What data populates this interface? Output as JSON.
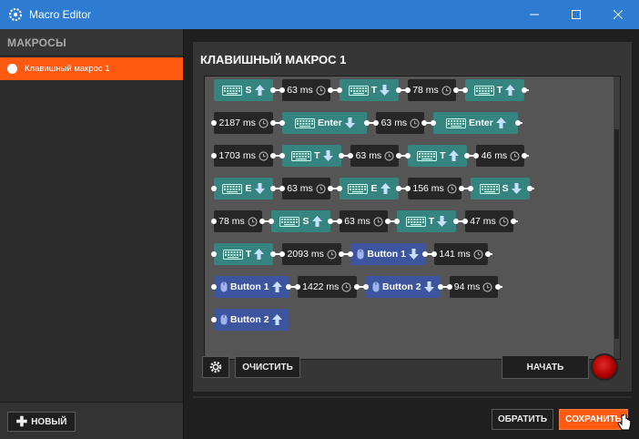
{
  "window": {
    "title": "Macro Editor",
    "icons": {
      "app": "steelseries-gear-icon",
      "minimize": "minimize-icon",
      "maximize": "maximize-icon",
      "close": "close-icon"
    }
  },
  "sidebar": {
    "header": "МАКРОСЫ",
    "items": [
      {
        "label": "Клавишный макрос 1",
        "selected": true
      }
    ],
    "new_button": "НОВЫЙ"
  },
  "main": {
    "title": "КЛАВИШНЫЙ МАКРОС 1",
    "sequence": [
      [
        {
          "type": "key",
          "label": "S",
          "dir": "up"
        },
        {
          "type": "delay",
          "label": "63 ms"
        },
        {
          "type": "key",
          "label": "T",
          "dir": "down"
        },
        {
          "type": "delay",
          "label": "78 ms"
        },
        {
          "type": "key",
          "label": "T",
          "dir": "up"
        }
      ],
      [
        {
          "type": "delay",
          "label": "2187 ms"
        },
        {
          "type": "key",
          "label": "Enter",
          "dir": "down"
        },
        {
          "type": "delay",
          "label": "63 ms"
        },
        {
          "type": "key",
          "label": "Enter",
          "dir": "up"
        }
      ],
      [
        {
          "type": "delay",
          "label": "1703 ms"
        },
        {
          "type": "key",
          "label": "T",
          "dir": "down"
        },
        {
          "type": "delay",
          "label": "63 ms"
        },
        {
          "type": "key",
          "label": "T",
          "dir": "up"
        },
        {
          "type": "delay",
          "label": "46 ms"
        }
      ],
      [
        {
          "type": "key",
          "label": "E",
          "dir": "down"
        },
        {
          "type": "delay",
          "label": "63 ms"
        },
        {
          "type": "key",
          "label": "E",
          "dir": "up"
        },
        {
          "type": "delay",
          "label": "156 ms"
        },
        {
          "type": "key",
          "label": "S",
          "dir": "down"
        }
      ],
      [
        {
          "type": "delay",
          "label": "78 ms"
        },
        {
          "type": "key",
          "label": "S",
          "dir": "up"
        },
        {
          "type": "delay",
          "label": "63 ms"
        },
        {
          "type": "key",
          "label": "T",
          "dir": "down"
        },
        {
          "type": "delay",
          "label": "47 ms"
        }
      ],
      [
        {
          "type": "key",
          "label": "T",
          "dir": "up"
        },
        {
          "type": "delay",
          "label": "2093 ms"
        },
        {
          "type": "mouse",
          "label": "Button 1",
          "dir": "down"
        },
        {
          "type": "delay",
          "label": "141 ms"
        }
      ],
      [
        {
          "type": "mouse",
          "label": "Button 1",
          "dir": "up"
        },
        {
          "type": "delay",
          "label": "1422 ms"
        },
        {
          "type": "mouse",
          "label": "Button 2",
          "dir": "down"
        },
        {
          "type": "delay",
          "label": "94 ms"
        }
      ],
      [
        {
          "type": "mouse",
          "label": "Button 2",
          "dir": "up"
        }
      ]
    ],
    "clear_button": "ОЧИСТИТЬ",
    "start_button": "НАЧАТЬ",
    "revert_button": "ОБРАТИТЬ",
    "save_button": "СОХРАНИТЬ"
  },
  "colors": {
    "accent": "#ff5a10",
    "titlebar": "#2d7cd1",
    "key_chip": "#358480",
    "mouse_chip": "#3c559e",
    "delay_chip": "#262626"
  }
}
